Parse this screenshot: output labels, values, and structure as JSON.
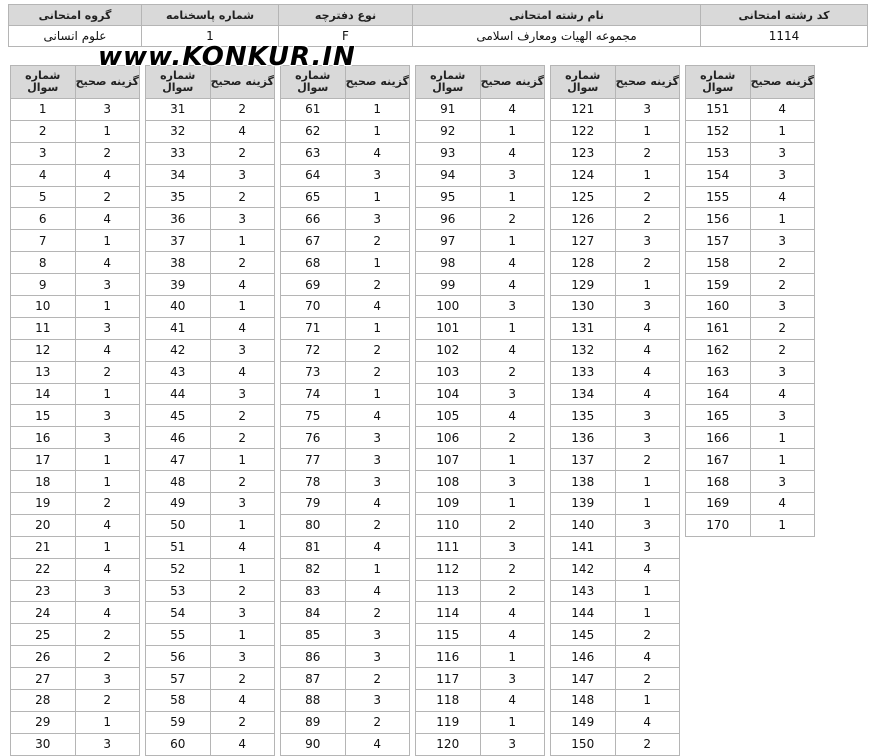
{
  "header": {
    "columns": [
      "کد رشته امتحانی",
      "نام رشته امتحانی",
      "نوع دفترچه",
      "شماره پاسخنامه",
      "گروه امتحانی"
    ],
    "values": [
      "1114",
      "مجموعه الهیات ومعارف اسلامی",
      "F",
      "1",
      "علوم انسانی"
    ]
  },
  "watermark": "www.KONKUR.IN",
  "answer_table": {
    "col_question": "شماره سوال",
    "col_answer": "گزینه صحیح",
    "answers": [
      3,
      1,
      2,
      4,
      2,
      4,
      1,
      4,
      3,
      1,
      3,
      4,
      2,
      1,
      3,
      3,
      1,
      1,
      2,
      4,
      1,
      4,
      3,
      4,
      2,
      2,
      3,
      2,
      1,
      3,
      2,
      4,
      2,
      3,
      2,
      3,
      1,
      2,
      4,
      1,
      4,
      3,
      4,
      3,
      2,
      2,
      1,
      2,
      3,
      1,
      4,
      1,
      2,
      3,
      1,
      3,
      2,
      4,
      2,
      4,
      1,
      1,
      4,
      3,
      1,
      3,
      2,
      1,
      2,
      4,
      1,
      2,
      2,
      1,
      4,
      3,
      3,
      3,
      4,
      2,
      4,
      1,
      4,
      2,
      3,
      3,
      2,
      3,
      2,
      4,
      4,
      1,
      4,
      3,
      1,
      2,
      1,
      4,
      4,
      3,
      1,
      4,
      2,
      3,
      4,
      2,
      1,
      3,
      1,
      2,
      3,
      2,
      2,
      4,
      4,
      1,
      3,
      4,
      1,
      3,
      3,
      1,
      2,
      1,
      2,
      2,
      3,
      2,
      1,
      3,
      4,
      4,
      4,
      4,
      3,
      3,
      2,
      1,
      1,
      3,
      3,
      4,
      1,
      1,
      2,
      4,
      2,
      1,
      4,
      2,
      4,
      1,
      3,
      3,
      4,
      1,
      3,
      2,
      2,
      3,
      2,
      2,
      3,
      4,
      3,
      1,
      1,
      3,
      4,
      1
    ]
  }
}
